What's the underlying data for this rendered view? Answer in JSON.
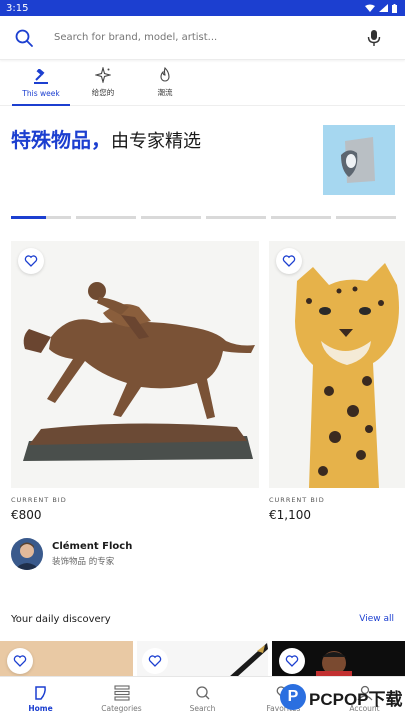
{
  "status_bar": {
    "time": "3:15"
  },
  "search": {
    "placeholder": "Search for brand, model, artist..."
  },
  "tabs": [
    {
      "label": "This week",
      "icon": "gavel-icon",
      "active": true
    },
    {
      "label": "给您的",
      "icon": "sparkle-icon",
      "active": false
    },
    {
      "label": "潮流",
      "icon": "flame-icon",
      "active": false
    }
  ],
  "hero": {
    "title_highlight": "特殊物品，",
    "title_rest": "由专家精选",
    "carousel_position": 1,
    "carousel_total": 6
  },
  "lots": [
    {
      "bid_label": "CURRENT BID",
      "bid_value": "€800",
      "subject": "bronze horse and jockey statue"
    },
    {
      "bid_label": "CURRENT BID",
      "bid_value": "€1,100",
      "subject": "ceramic leopard statue"
    }
  ],
  "expert": {
    "name": "Clément Floch",
    "category": "装饰物品 的专家"
  },
  "discovery": {
    "title": "Your daily discovery",
    "view_all": "View all"
  },
  "bottom_nav": [
    {
      "label": "Home",
      "icon": "home-icon",
      "active": true
    },
    {
      "label": "Categories",
      "icon": "categories-icon",
      "active": false
    },
    {
      "label": "Search",
      "icon": "search-icon",
      "active": false
    },
    {
      "label": "Favorites",
      "icon": "heart-icon",
      "active": false
    },
    {
      "label": "Account",
      "icon": "account-icon",
      "active": false
    }
  ],
  "watermark": {
    "letter": "P",
    "brand": "PCPOP",
    "suffix": "下载"
  },
  "colors": {
    "accent": "#1c3fd0",
    "status_bar": "#1c3fd0"
  }
}
